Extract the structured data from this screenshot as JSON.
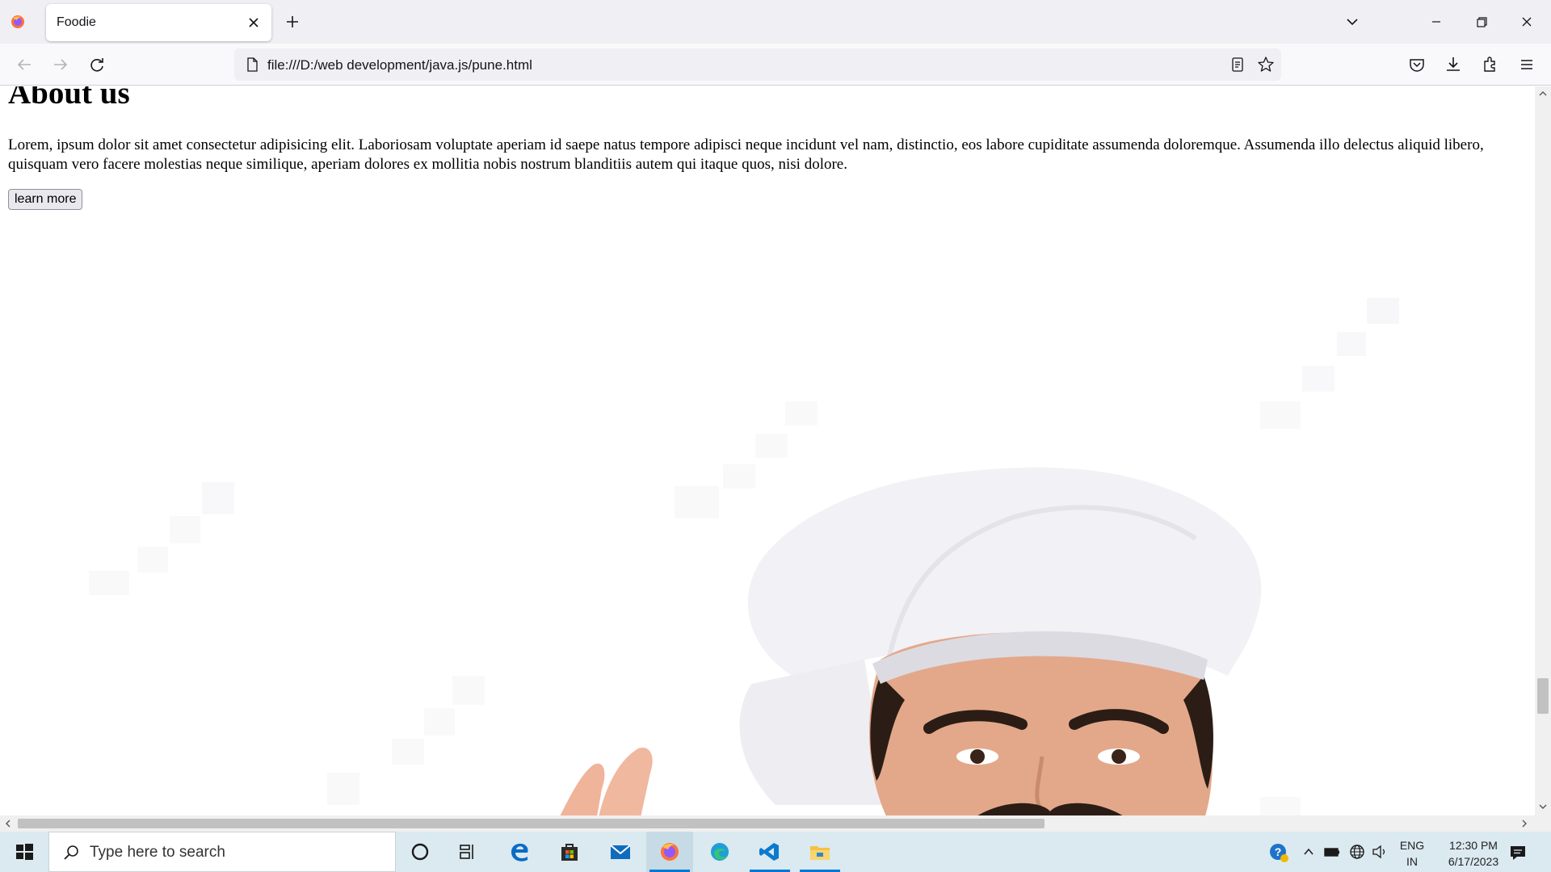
{
  "browser": {
    "tab_title": "Foodie",
    "url": "file:///D:/web development/java.js/pune.html"
  },
  "page": {
    "heading": "About us",
    "paragraph": "Lorem, ipsum dolor sit amet consectetur adipisicing elit. Laboriosam voluptate aperiam id saepe natus tempore adipisci neque incidunt vel nam, distinctio, eos labore cupiditate assumenda doloremque. Assumenda illo delectus aliquid libero, quisquam vero facere molestias neque similique, aperiam dolores ex mollitia nobis nostrum blanditiis autem qui itaque quos, nisi dolore.",
    "button_label": "learn more",
    "image_subject": "chef-in-white-hat"
  },
  "scroll": {
    "vertical_position_fraction": 0.83,
    "horizontal_visible_fraction": 0.68
  },
  "taskbar": {
    "search_placeholder": "Type here to search",
    "apps": [
      "cortana-icon",
      "task-view-icon",
      "edge-legacy-icon",
      "store-icon",
      "mail-icon",
      "firefox-icon",
      "edge-icon",
      "vscode-icon",
      "file-explorer-icon"
    ],
    "active_apps": [
      "firefox-icon",
      "vscode-icon",
      "file-explorer-icon"
    ],
    "language_line1": "ENG",
    "language_line2": "IN",
    "time": "12:30 PM",
    "date": "6/17/2023"
  },
  "colors": {
    "accent": "#0078d4",
    "taskbar_bg": "#dbe9f0"
  }
}
